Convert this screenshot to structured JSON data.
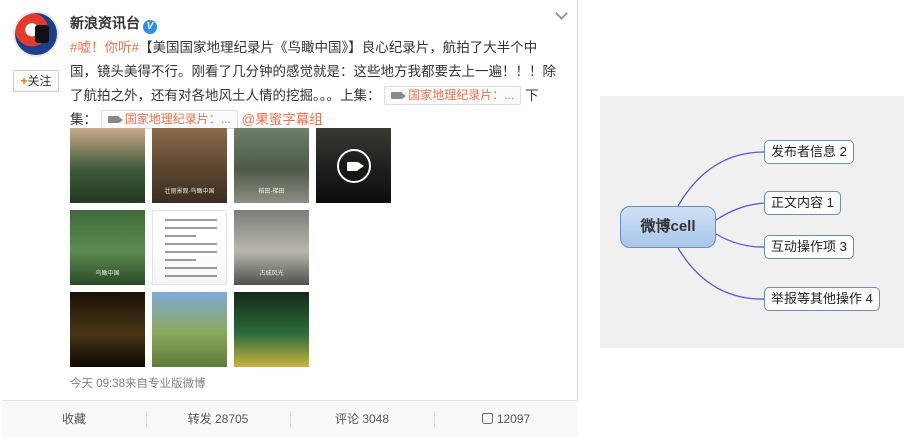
{
  "post": {
    "username": "新浪资讯台",
    "verified_mark": "V",
    "follow_label": "关注",
    "follow_plus": "+",
    "text": {
      "topic": "#嘘！你听#",
      "part1": "【美国国家地理纪录片《鸟瞰中国》】良心纪录片，航拍了大半个中国，镜头美得不行。刚看了几分钟的感觉就是：这些地方我都要去上一遍！！！除了航拍之外，还有对各地风土人情的挖掘。。。上集：",
      "chip1": "国家地理纪录片：...",
      "part2": "下集：",
      "chip2": "国家地理纪录片：...",
      "mention": "@果蜜字幕组"
    },
    "thumbs": [
      {
        "kind": "photo",
        "colors": [
          "#c9a98a",
          "#3d5a3a",
          "#243821"
        ],
        "caption": ""
      },
      {
        "kind": "photo",
        "colors": [
          "#8a6a4a",
          "#5b4630",
          "#3b2d20"
        ],
        "caption": "壮丽景观·鸟瞰中国"
      },
      {
        "kind": "photo",
        "colors": [
          "#6f7f6a",
          "#4d5b46",
          "#8c8f85"
        ],
        "caption": "稻田·梯田"
      },
      {
        "kind": "video",
        "colors": [
          "#3a3a34",
          "#1e1e1b",
          "#0d0d0c"
        ],
        "caption": ""
      },
      {
        "kind": "photo",
        "colors": [
          "#3f6b3a",
          "#5d8a50",
          "#2a4a28"
        ],
        "caption": "鸟瞰中国"
      },
      {
        "kind": "doc",
        "colors": [
          "#ffffff",
          "#ffffff",
          "#f4f4f4"
        ],
        "caption": ""
      },
      {
        "kind": "photo",
        "colors": [
          "#7d7e7a",
          "#b8b6ae",
          "#4f4f4c"
        ],
        "caption": "古城风光"
      },
      {
        "kind": "photo",
        "colors": [
          "#1a1208",
          "#4a3516",
          "#0c0804"
        ],
        "caption": ""
      },
      {
        "kind": "photo",
        "colors": [
          "#7fa8d8",
          "#8aa85a",
          "#5e7a3a"
        ],
        "caption": ""
      },
      {
        "kind": "photo",
        "colors": [
          "#152a18",
          "#2c6a3a",
          "#c8b440"
        ],
        "caption": ""
      }
    ],
    "meta": "今天 09:38来自专业版微博",
    "actions": {
      "favorite": "收藏",
      "repost": "转发 28705",
      "comment": "评论 3048",
      "like": "12097"
    }
  },
  "mindmap": {
    "root": "微博cell",
    "nodes": [
      {
        "label": "发布者信息 2"
      },
      {
        "label": "正文内容 1"
      },
      {
        "label": "互动操作项 3"
      },
      {
        "label": "举报等其他操作 4"
      }
    ]
  },
  "colors": {
    "accent": "#eb7350",
    "node_border": "#6a8cc0",
    "connector": "#5a5ad0",
    "verified": "#2f8ee8"
  }
}
